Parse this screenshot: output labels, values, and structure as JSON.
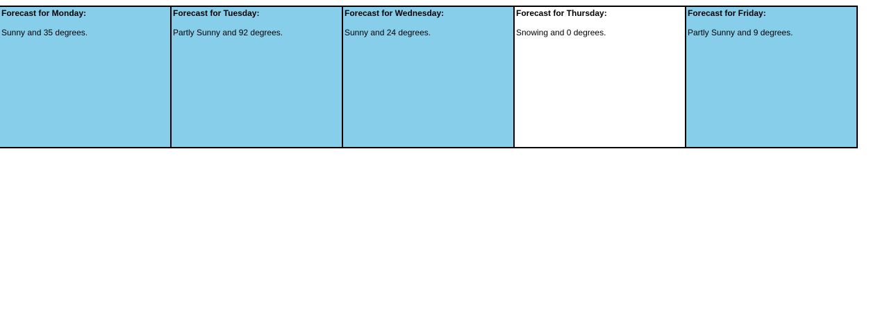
{
  "colors": {
    "sunny_bg": "#87ceeb",
    "snow_bg": "#ffffff",
    "border": "#000000"
  },
  "forecast": {
    "days": [
      {
        "title": "Forecast for Monday:",
        "description": "Sunny and 35 degrees.",
        "bg": "#87ceeb"
      },
      {
        "title": "Forecast for Tuesday:",
        "description": "Partly Sunny and 92 degrees.",
        "bg": "#87ceeb"
      },
      {
        "title": "Forecast for Wednesday:",
        "description": "Sunny and 24 degrees.",
        "bg": "#87ceeb"
      },
      {
        "title": "Forecast for Thursday:",
        "description": "Snowing and 0 degrees.",
        "bg": "#ffffff"
      },
      {
        "title": "Forecast for Friday:",
        "description": "Partly Sunny and 9 degrees.",
        "bg": "#87ceeb"
      }
    ]
  }
}
